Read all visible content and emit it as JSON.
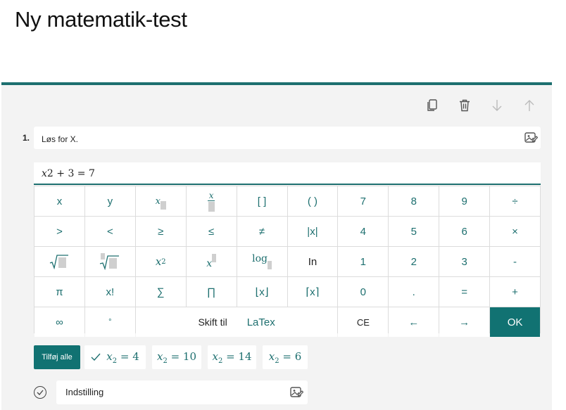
{
  "page": {
    "title": "Ny matematik-test"
  },
  "toolbar": {
    "icons": [
      "copy-icon",
      "trash-icon",
      "arrow-down-icon",
      "arrow-up-icon"
    ]
  },
  "question": {
    "number": "1.",
    "text": "Løs for X.",
    "expression": {
      "var": "x",
      "rest": "2  + 3 = 7"
    }
  },
  "keypad": {
    "row1": [
      "x",
      "y",
      "[ ]",
      "( )",
      "7",
      "8",
      "9",
      "÷"
    ],
    "row2": [
      ">",
      "<",
      "≥",
      "≤",
      "≠",
      "|x|",
      "4",
      "5",
      "6",
      "×"
    ],
    "row3": {
      "sup_base": "x",
      "sup_exp": "2",
      "log": "log",
      "ln": "In",
      "d1": "1",
      "d2": "2",
      "d3": "3",
      "minus": "-"
    },
    "row4": [
      "π",
      "x!",
      "∑",
      "∏",
      "⌊x⌋",
      "⌈x⌉",
      "0",
      ".",
      "=",
      "+"
    ],
    "row5": {
      "infinity": "∞",
      "degree": "°",
      "switch": "Skift til",
      "latex": "LaTex",
      "ce": "CE",
      "left": "←",
      "right": "→",
      "ok": "OK"
    }
  },
  "suggestions": {
    "add_all": "Tilføj alle",
    "chips": [
      {
        "var": "x",
        "sub": "2",
        "eq": "= 4"
      },
      {
        "var": "x",
        "sub": "2",
        "eq": "= 10"
      },
      {
        "var": "x",
        "sub": "2",
        "eq": "= 14"
      },
      {
        "var": "x",
        "sub": "2",
        "eq": "= 6"
      }
    ]
  },
  "option": {
    "text": "Indstilling"
  },
  "colors": {
    "accent": "#117272",
    "border": "#1d6f6f",
    "card": "#f3f3f3"
  }
}
